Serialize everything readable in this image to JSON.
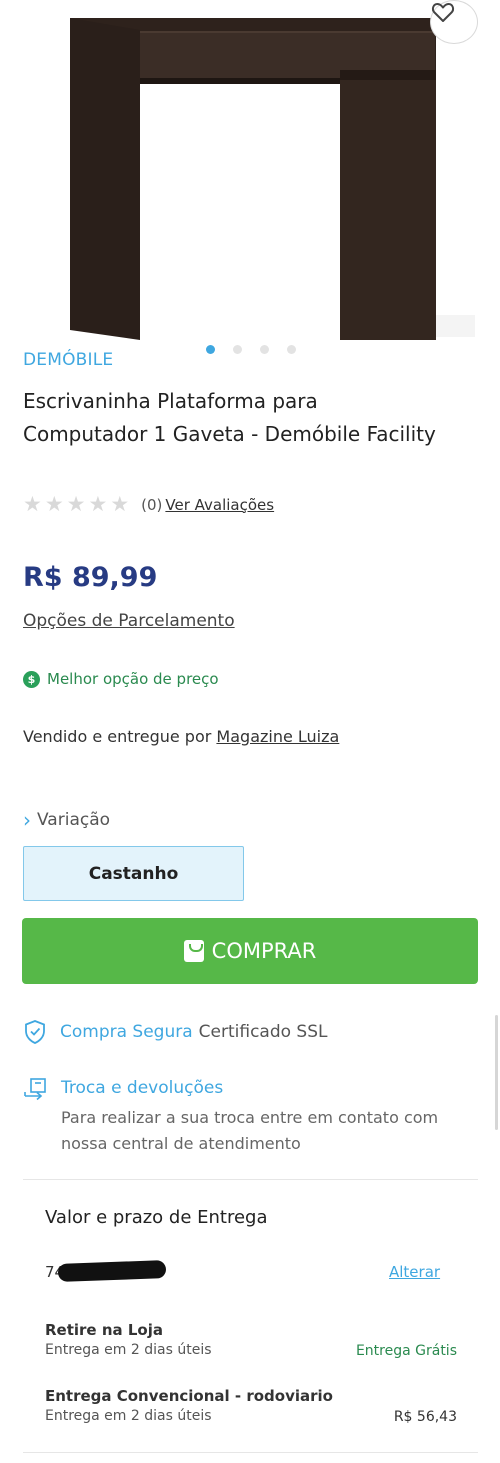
{
  "product": {
    "brand": "DEMÓBILE",
    "title": "Escrivaninha Plataforma para Computador 1 Gaveta - Demóbile Facility",
    "image_slides": 4,
    "active_slide": 1,
    "rating_stars": 0,
    "reviews_count": "(0)",
    "reviews_link": "Ver Avaliações",
    "price": "R$ 89,99",
    "installments_link": "Opções de Parcelamento",
    "best_price_badge": "Melhor opção de preço",
    "seller_prefix": "Vendido e entregue por",
    "seller_name": "Magazine Luiza"
  },
  "variation": {
    "label": "Variação",
    "selected": "Castanho"
  },
  "buy_button": {
    "label": "COMPRAR"
  },
  "secure": {
    "label": "Compra Segura",
    "cert": "Certificado SSL"
  },
  "exchange": {
    "label": "Troca e devoluções",
    "description": "Para realizar a sua troca entre em contato com nossa central de atendimento"
  },
  "delivery": {
    "title": "Valor e prazo de Entrega",
    "zip_visible": "74",
    "change_link": "Alterar",
    "options": [
      {
        "name": "Retire na Loja",
        "time": "Entrega em 2 dias úteis",
        "price": "Entrega Grátis"
      },
      {
        "name": "Entrega Convencional - rodoviario",
        "time": "Entrega em 2 dias úteis",
        "price": "R$ 56,43"
      }
    ]
  },
  "colors": {
    "accent_blue": "#3fa7e0",
    "price_blue": "#273b83",
    "buy_green": "#56b848",
    "success_green": "#2a8a4f"
  }
}
